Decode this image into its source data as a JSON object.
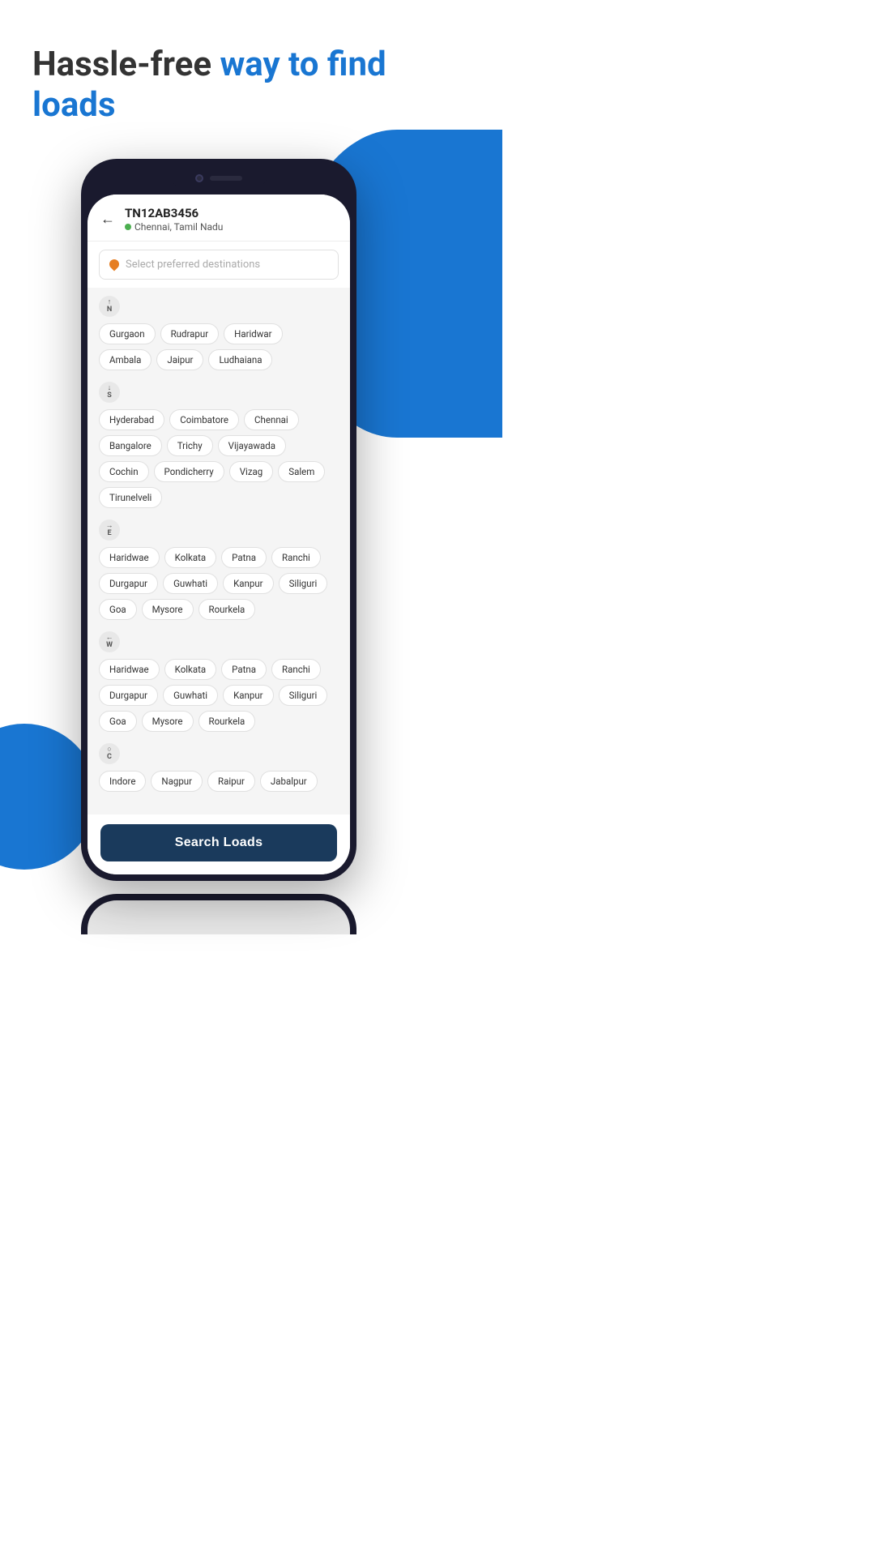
{
  "header": {
    "line1_black": "Hassle-free ",
    "line1_blue": "way to find",
    "line2_blue": "loads"
  },
  "phone": {
    "vehicle_id": "TN12AB3456",
    "location": "Chennai, Tamil Nadu",
    "search_placeholder": "Select preferred destinations",
    "back_icon": "←",
    "directions": [
      {
        "id": "north",
        "label": "N",
        "sublabel": "↑",
        "tags": [
          "Gurgaon",
          "Rudrapur",
          "Haridwar",
          "Ambala",
          "Jaipur",
          "Ludhaiana"
        ]
      },
      {
        "id": "south",
        "label": "S",
        "sublabel": "↓",
        "tags": [
          "Hyderabad",
          "Coimbatore",
          "Chennai",
          "Bangalore",
          "Trichy",
          "Vijayawada",
          "Cochin",
          "Pondicherry",
          "Vizag",
          "Salem",
          "Tirunelveli"
        ]
      },
      {
        "id": "east",
        "label": "E",
        "sublabel": "→",
        "tags": [
          "Haridwae",
          "Kolkata",
          "Patna",
          "Ranchi",
          "Durgapur",
          "Guwhati",
          "Kanpur",
          "Siliguri",
          "Goa",
          "Mysore",
          "Rourkela"
        ]
      },
      {
        "id": "west",
        "label": "W",
        "sublabel": "←",
        "tags": [
          "Haridwae",
          "Kolkata",
          "Patna",
          "Ranchi",
          "Durgapur",
          "Guwhati",
          "Kanpur",
          "Siliguri",
          "Goa",
          "Mysore",
          "Rourkela"
        ]
      },
      {
        "id": "central",
        "label": "C",
        "sublabel": "○",
        "tags": [
          "Indore",
          "Nagpur",
          "Raipur",
          "Jabalpur"
        ]
      }
    ],
    "search_button": "Search Loads"
  }
}
